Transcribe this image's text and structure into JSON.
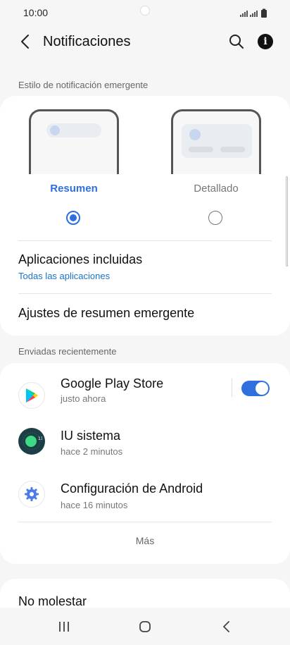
{
  "status": {
    "time": "10:00",
    "icons": "signal-wifi-battery"
  },
  "header": {
    "title": "Notificaciones"
  },
  "popup_style": {
    "section_label": "Estilo de notificación emergente",
    "options": [
      {
        "label": "Resumen",
        "selected": true
      },
      {
        "label": "Detallado",
        "selected": false
      }
    ],
    "included_apps": {
      "title": "Aplicaciones incluidas",
      "value": "Todas las aplicaciones"
    },
    "summary_settings": {
      "title": "Ajustes de resumen emergente"
    }
  },
  "recent": {
    "section_label": "Enviadas recientemente",
    "apps": [
      {
        "name": "Google Play Store",
        "time": "justo ahora",
        "toggle_on": true,
        "icon": "play-store-icon"
      },
      {
        "name": "IU sistema",
        "time": "hace 2 minutos",
        "icon": "system-ui-icon"
      },
      {
        "name": "Configuración de Android",
        "time": "hace 16 minutos",
        "icon": "settings-gear-icon"
      }
    ],
    "more_label": "Más"
  },
  "dnd": {
    "title": "No molestar"
  },
  "colors": {
    "accent": "#2f6fde",
    "link": "#1a73c8"
  }
}
